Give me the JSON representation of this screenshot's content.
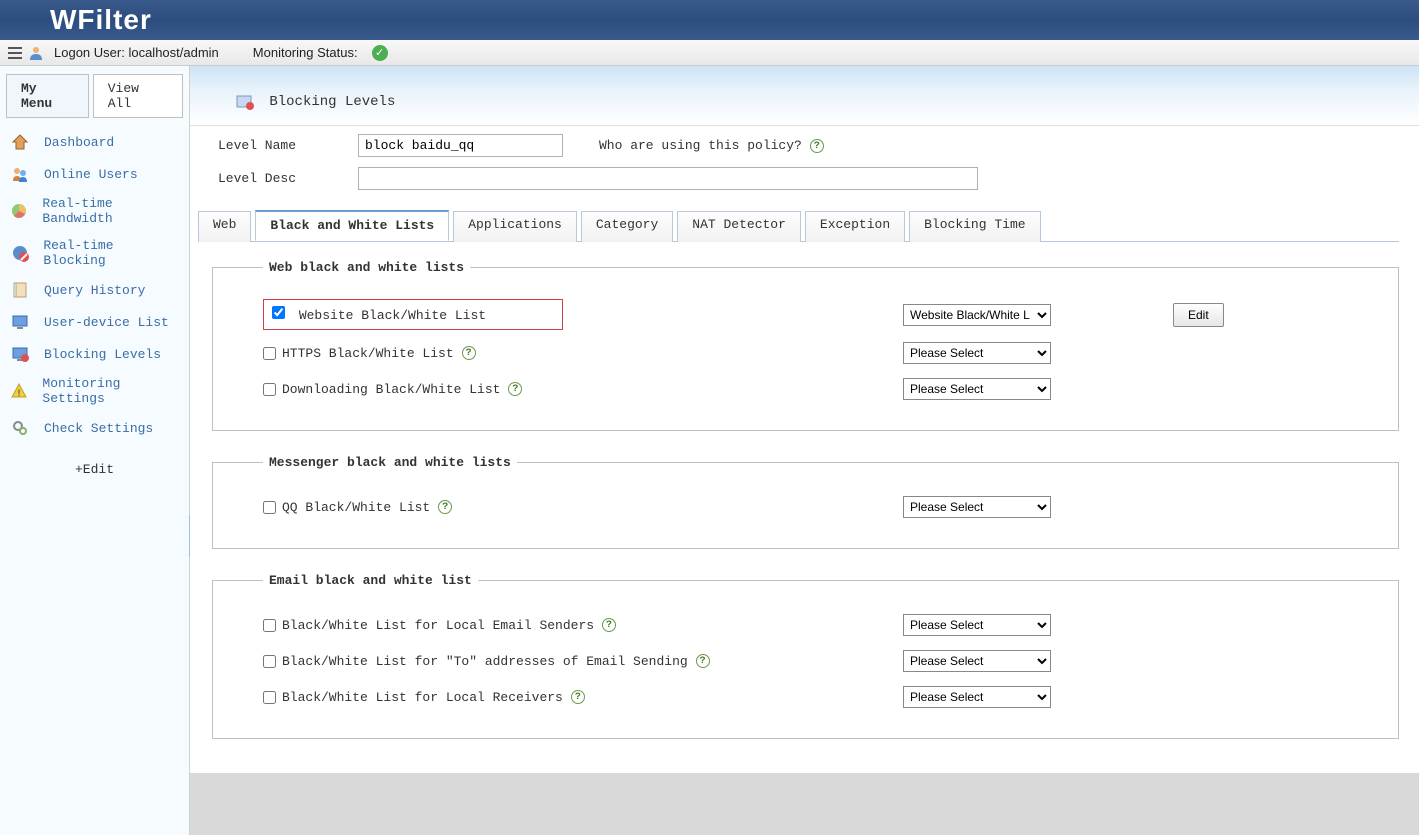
{
  "app": {
    "name": "WFilter"
  },
  "toolbar": {
    "login_label": "Logon User:",
    "login_value": "localhost/admin",
    "monitoring_label": "Monitoring Status:"
  },
  "sidebar": {
    "tabs": {
      "my_menu": "My Menu",
      "view_all": "View All"
    },
    "items": [
      {
        "label": "Dashboard"
      },
      {
        "label": "Online Users"
      },
      {
        "label": "Real-time Bandwidth"
      },
      {
        "label": "Real-time Blocking"
      },
      {
        "label": "Query History"
      },
      {
        "label": "User-device List"
      },
      {
        "label": "Blocking Levels"
      },
      {
        "label": "Monitoring Settings"
      },
      {
        "label": "Check Settings"
      }
    ],
    "edit": "+Edit"
  },
  "page": {
    "title": "Blocking Levels",
    "level_name_label": "Level Name",
    "level_name_value": "block baidu_qq",
    "level_desc_label": "Level Desc",
    "level_desc_value": "",
    "policy_question": "Who are using this policy?"
  },
  "tabs": {
    "web": "Web",
    "bwlists": "Black and White Lists",
    "applications": "Applications",
    "category": "Category",
    "nat": "NAT Detector",
    "exception": "Exception",
    "blocking_time": "Blocking Time"
  },
  "sections": {
    "web": {
      "legend": "Web black and white lists",
      "website": {
        "label": "Website Black/White List",
        "checked": true,
        "select": "Website Black/White L",
        "edit": "Edit"
      },
      "https": {
        "label": "HTTPS Black/White List",
        "checked": false,
        "select": "Please Select"
      },
      "download": {
        "label": "Downloading Black/White List",
        "checked": false,
        "select": "Please Select"
      }
    },
    "messenger": {
      "legend": "Messenger black and white lists",
      "qq": {
        "label": "QQ Black/White List",
        "checked": false,
        "select": "Please Select"
      }
    },
    "email": {
      "legend": "Email black and white list",
      "local_senders": {
        "label": "Black/White List for Local Email Senders",
        "checked": false,
        "select": "Please Select"
      },
      "to_addresses": {
        "label": "Black/White List for \"To\" addresses of Email Sending",
        "checked": false,
        "select": "Please Select"
      },
      "local_receivers": {
        "label": "Black/White List for Local Receivers",
        "checked": false,
        "select": "Please Select"
      }
    }
  }
}
